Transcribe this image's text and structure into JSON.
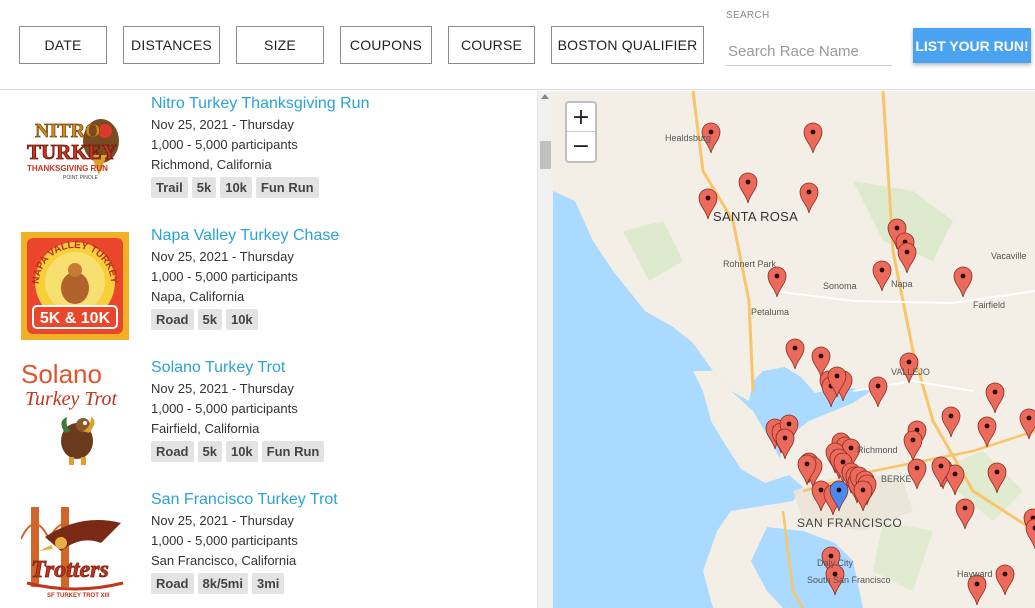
{
  "filters": {
    "date": "DATE",
    "distances": "DISTANCES",
    "size": "SIZE",
    "coupons": "COUPONS",
    "course": "COURSE",
    "boston": "BOSTON QUALIFIER"
  },
  "search": {
    "label": "SEARCH",
    "placeholder": "Search Race Name"
  },
  "list_button": "LIST YOUR RUN!",
  "races": [
    {
      "title": "Nitro Turkey Thanksgiving Run",
      "date": "Nov 25, 2021 - Thursday",
      "participants": "1,000 - 5,000 participants",
      "location": "Richmond, California",
      "tags": [
        "Trail",
        "5k",
        "10k",
        "Fun Run"
      ],
      "logo": {
        "line1": "NITRO",
        "line2": "TURKEY",
        "line3": "THANKSGIVING RUN",
        "line4": "POINT PINOLE"
      }
    },
    {
      "title": "Napa Valley Turkey Chase",
      "date": "Nov 25, 2021 - Thursday",
      "participants": "1,000 - 5,000 participants",
      "location": "Napa, California",
      "tags": [
        "Road",
        "5k",
        "10k"
      ],
      "logo": {
        "arc": "NAPA VALLEY TURKEY CHASE",
        "bottom": "5K & 10K"
      }
    },
    {
      "title": "Solano Turkey Trot",
      "date": "Nov 25, 2021 - Thursday",
      "participants": "1,000 - 5,000 participants",
      "location": "Fairfield, California",
      "tags": [
        "Road",
        "5k",
        "10k",
        "Fun Run"
      ],
      "logo": {
        "line1": "Solano",
        "line2": "Turkey Trot"
      }
    },
    {
      "title": "San Francisco Turkey Trot",
      "date": "Nov 25, 2021 - Thursday",
      "participants": "1,000 - 5,000 participants",
      "location": "San Francisco, California",
      "tags": [
        "Road",
        "8k/5mi",
        "3mi"
      ],
      "logo": {
        "script": "Trotters",
        "bottom": "SF TURKEY TROT XIII"
      }
    }
  ],
  "map": {
    "zoom_in": "+",
    "zoom_out": "−",
    "labels": {
      "healdsburg": "Healdsburg",
      "santa_rosa": "SANTA ROSA",
      "rohnert_park": "Rohnert Park",
      "sonoma": "Sonoma",
      "napa": "Napa",
      "vacaville": "Vacaville",
      "fairfield": "Fairfield",
      "petaluma": "Petaluma",
      "vallejo": "VALLEJO",
      "richmond": "Richmond",
      "berkeley": "BERKE",
      "san_francisco": "SAN FRANCISCO",
      "daly_city": "Daly City",
      "south_sf": "South San Francisco",
      "hayward": "Hayward"
    },
    "colors": {
      "land": "#f3efe6",
      "water": "#aadaff",
      "marker": "#ec6a5c",
      "marker_selected": "#4a8af0",
      "park": "#d4e8c2"
    }
  }
}
